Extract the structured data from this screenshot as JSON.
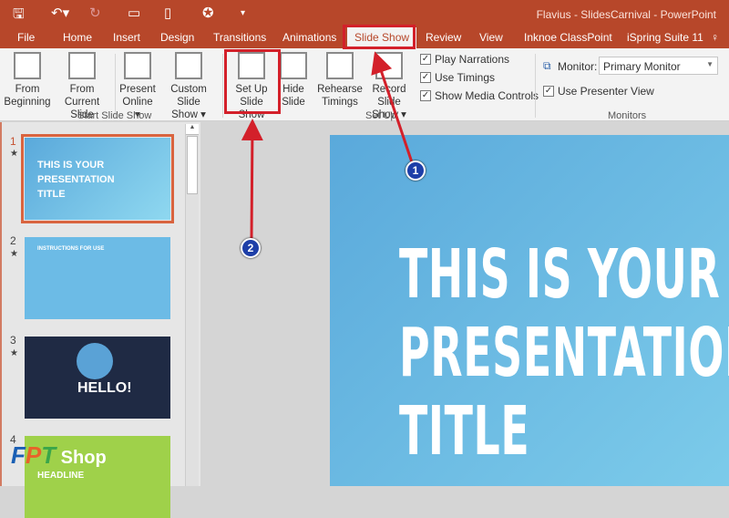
{
  "window": {
    "title": "Flavius - SlidesCarnival - PowerPoint"
  },
  "tabs": [
    "File",
    "Home",
    "Insert",
    "Design",
    "Transitions",
    "Animations",
    "Slide Show",
    "Review",
    "View",
    "Inknoe ClassPoint",
    "iSpring Suite 11"
  ],
  "active_tab": "Slide Show",
  "ribbon": {
    "start": {
      "from_beginning": [
        "From",
        "Beginning"
      ],
      "from_current": [
        "From",
        "Current Slide"
      ],
      "present_online": [
        "Present",
        "Online ▾"
      ],
      "custom_show": [
        "Custom Slide",
        "Show ▾"
      ],
      "label": "Start Slide Show"
    },
    "setup": {
      "setup_show": [
        "Set Up",
        "Slide Show"
      ],
      "hide_slide": [
        "Hide",
        "Slide"
      ],
      "rehearse": [
        "Rehearse",
        "Timings"
      ],
      "record": [
        "Record Slide",
        "Show ▾"
      ],
      "label": "Set Up",
      "checks": [
        {
          "label": "Play Narrations",
          "checked": true
        },
        {
          "label": "Use Timings",
          "checked": true
        },
        {
          "label": "Show Media Controls",
          "checked": true
        }
      ]
    },
    "monitors": {
      "monitor_label": "Monitor:",
      "monitor_value": "Primary Monitor",
      "presenter_view": "Use Presenter View",
      "presenter_checked": true,
      "label": "Monitors"
    }
  },
  "slides": [
    {
      "num": "1",
      "title": "THIS IS YOUR PRESENTATION TITLE",
      "bg": "#5fb0e0"
    },
    {
      "num": "2",
      "title": "INSTRUCTIONS FOR USE",
      "bg": "#6cbbe6"
    },
    {
      "num": "3",
      "title": "HELLO!",
      "bg": "#1f2a44"
    },
    {
      "num": "4",
      "title": "HEADLINE",
      "bg": "#9fd14a"
    }
  ],
  "slide_main": {
    "lines": [
      "THIS IS YOUR",
      "PRESENTATION",
      "TITLE"
    ]
  },
  "annotations": [
    "1",
    "2"
  ],
  "watermark": "FPT Shop.com.vn",
  "colors": {
    "accent": "#b7472a",
    "highlight": "#d3202a",
    "badge": "#1e3fa8"
  }
}
